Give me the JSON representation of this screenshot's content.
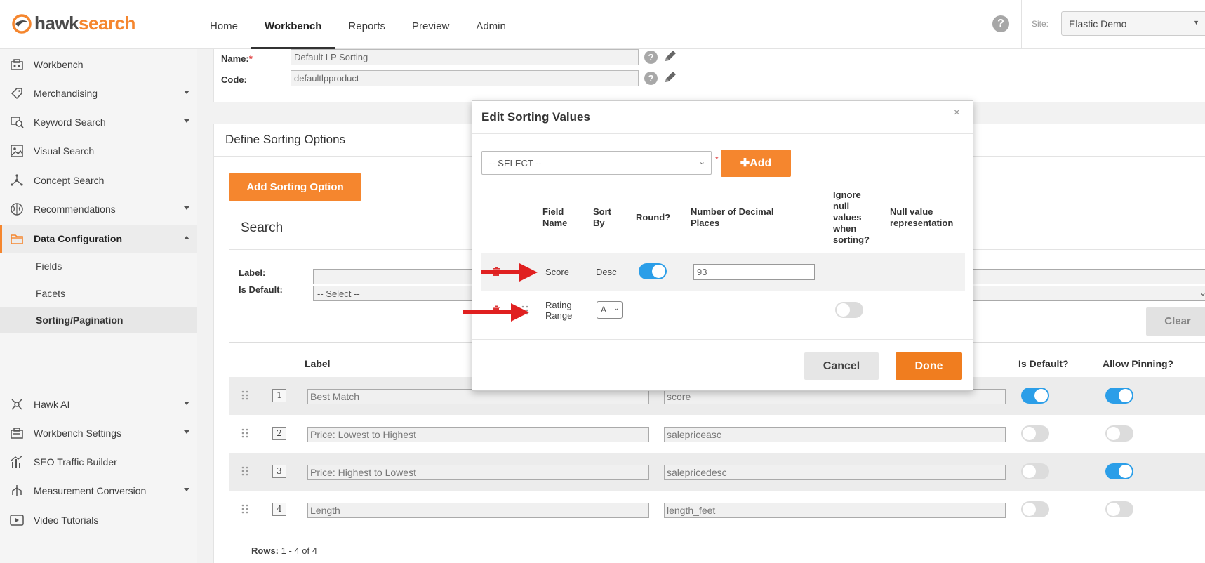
{
  "brand": {
    "part1": "hawk",
    "part2": "search"
  },
  "nav": {
    "items": [
      "Home",
      "Workbench",
      "Reports",
      "Preview",
      "Admin"
    ],
    "active": "Workbench"
  },
  "header": {
    "help": "?",
    "site_label": "Site:",
    "site_value": "Elastic Demo"
  },
  "sidebar": {
    "items": [
      {
        "label": "Workbench",
        "icon": "workbench-icon"
      },
      {
        "label": "Merchandising",
        "icon": "merchandising-icon"
      },
      {
        "label": "Keyword Search",
        "icon": "keyword-search-icon"
      },
      {
        "label": "Visual Search",
        "icon": "image-icon"
      },
      {
        "label": "Concept Search",
        "icon": "network-icon"
      },
      {
        "label": "Recommendations",
        "icon": "brain-icon"
      },
      {
        "label": "Data Configuration",
        "icon": "folder-icon"
      },
      {
        "label": "Hawk AI",
        "icon": "hawk-ai-icon"
      },
      {
        "label": "Workbench Settings",
        "icon": "settings-icon"
      },
      {
        "label": "SEO Traffic Builder",
        "icon": "chart-icon"
      },
      {
        "label": "Measurement Conversion",
        "icon": "conversion-icon"
      },
      {
        "label": "Video Tutorials",
        "icon": "video-icon"
      }
    ],
    "subitems": [
      "Fields",
      "Facets",
      "Sorting/Pagination"
    ]
  },
  "form": {
    "name_label": "Name:",
    "name_required": "*",
    "name_value": "Default LP Sorting",
    "code_label": "Code:",
    "code_value": "defaultlpproduct",
    "help": "?"
  },
  "sorting": {
    "title": "Define Sorting Options",
    "add_button": "Add Sorting Option",
    "search_title": "Search",
    "label_label": "Label:",
    "is_default_label": "Is Default:",
    "is_default_value": "-- Select --",
    "clear": "Clear",
    "columns": {
      "label": "Label",
      "is_default": "Is Default?",
      "allow_pinning": "Allow Pinning?"
    },
    "rows": [
      {
        "num": "1",
        "label": "Best Match",
        "code": "score",
        "is_default": true,
        "allow_pinning": true
      },
      {
        "num": "2",
        "label": "Price: Lowest to Highest",
        "code": "salepriceasc",
        "is_default": false,
        "allow_pinning": false
      },
      {
        "num": "3",
        "label": "Price: Highest to Lowest",
        "code": "salepricedesc",
        "is_default": false,
        "allow_pinning": true
      },
      {
        "num": "4",
        "label": "Length",
        "code": "length_feet",
        "is_default": false,
        "allow_pinning": false
      }
    ],
    "rows_label": "Rows:",
    "rows_count": "1 - 4 of 4"
  },
  "modal": {
    "title": "Edit Sorting Values",
    "close": "×",
    "select_placeholder": "-- SELECT --",
    "required": "*",
    "add_button": "Add",
    "headers": {
      "field_name": [
        "Field",
        "Name"
      ],
      "sort_by": [
        "Sort",
        "By"
      ],
      "round": "Round?",
      "decimal": [
        "Number of Decimal",
        "Places"
      ],
      "ignore_null": [
        "Ignore",
        "null",
        "values",
        "when",
        "sorting?"
      ],
      "null_value": [
        "Null value",
        "representation"
      ]
    },
    "rows": [
      {
        "field": "Score",
        "sort_by": "Desc",
        "round": true,
        "decimal": "93"
      },
      {
        "field_line1": "Rating",
        "field_line2": "Range",
        "sort_by": "A",
        "ignore_null": false
      }
    ],
    "cancel": "Cancel",
    "done": "Done"
  },
  "colors": {
    "accent": "#f5862e",
    "toggle_on": "#2b9ee8",
    "annotation_arrow": "#e02020"
  }
}
